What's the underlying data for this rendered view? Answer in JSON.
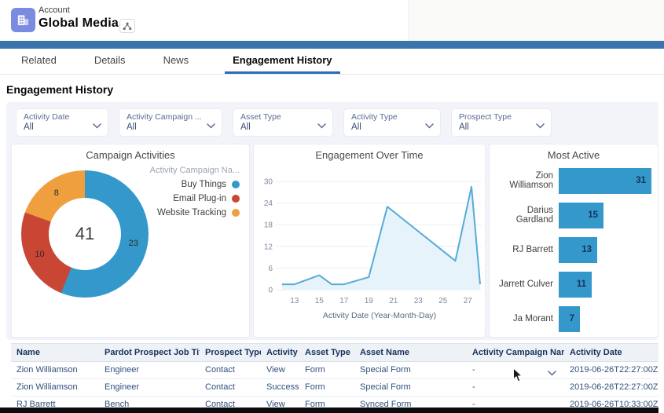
{
  "header": {
    "record_type": "Account",
    "title": "Global Media"
  },
  "tabs": [
    {
      "label": "Related",
      "active": false
    },
    {
      "label": "Details",
      "active": false
    },
    {
      "label": "News",
      "active": false
    },
    {
      "label": "Engagement History",
      "active": true
    }
  ],
  "section_title": "Engagement History",
  "filters": [
    {
      "label": "Activity Date",
      "value": "All"
    },
    {
      "label": "Activity Campaign ...",
      "value": "All"
    },
    {
      "label": "Asset Type",
      "value": "All"
    },
    {
      "label": "Activity Type",
      "value": "All"
    },
    {
      "label": "Prospect Type",
      "value": "All"
    }
  ],
  "colors": {
    "brand_bar": "#3b74ad",
    "tab_accent": "#2b6cb3",
    "dashboard_bg": "#f3f4fa",
    "chart_blue": "#3598ca",
    "chart_red": "#c84633",
    "chart_orange": "#f09f3e",
    "line_stroke": "#55acd6",
    "line_fill": "#e7f3fa"
  },
  "chart_data": [
    {
      "type": "pie",
      "title": "Campaign Activities",
      "legend_title": "Activity Campaign Na...",
      "total": 41,
      "slices": [
        {
          "label": "Buy Things",
          "value": 23,
          "color": "#3598ca"
        },
        {
          "label": "Email Plug-in",
          "value": 10,
          "color": "#c84633"
        },
        {
          "label": "Website Tracking",
          "value": 8,
          "color": "#f09f3e"
        }
      ]
    },
    {
      "type": "area",
      "title": "Engagement Over Time",
      "xlabel": "Activity Date (Year-Month-Day)",
      "x": [
        12,
        13,
        15,
        16,
        17,
        19,
        20.5,
        26,
        27.3,
        28
      ],
      "y": [
        1.5,
        1.5,
        4,
        1.5,
        1.5,
        3.5,
        23,
        8,
        28.5,
        1.5
      ],
      "xticks": [
        13,
        15,
        17,
        19,
        21,
        23,
        25,
        27
      ],
      "yticks": [
        0,
        6,
        12,
        18,
        24,
        30
      ],
      "xlim": [
        12,
        28
      ],
      "ylim": [
        0,
        30
      ],
      "grid": true
    },
    {
      "type": "bar",
      "title": "Most Active",
      "orientation": "horizontal",
      "categories": [
        "Zion Williamson",
        "Darius Gardland",
        "RJ Barrett",
        "Jarrett Culver",
        "Ja Morant"
      ],
      "values": [
        31,
        15,
        13,
        11,
        7
      ],
      "xlim": [
        0,
        31
      ]
    }
  ],
  "table": {
    "columns": [
      "Name",
      "Pardot Prospect Job Title",
      "Prospect Type",
      "Activity",
      "Asset Type",
      "Asset Name",
      "Activity Campaign Name",
      "Activity Date"
    ],
    "rows": [
      [
        "Zion Williamson",
        "Engineer",
        "Contact",
        "View",
        "Form",
        "Special Form",
        "-",
        "2019-06-26T22:27:00Z"
      ],
      [
        "Zion Williamson",
        "Engineer",
        "Contact",
        "Success",
        "Form",
        "Special Form",
        "-",
        "2019-06-26T22:27:00Z"
      ],
      [
        "RJ Barrett",
        "Bench",
        "Contact",
        "View",
        "Form",
        "Synced Form",
        "-",
        "2019-06-26T10:33:00Z"
      ]
    ],
    "hover_row_chevron": 0
  }
}
